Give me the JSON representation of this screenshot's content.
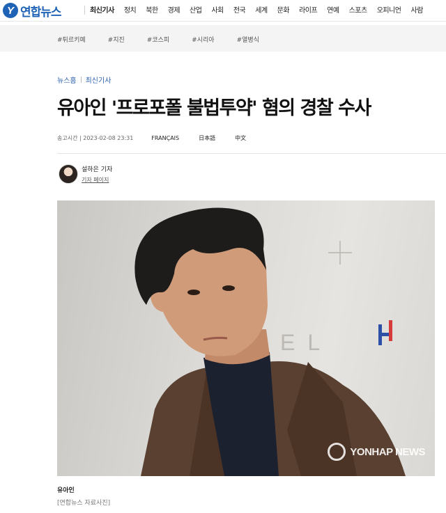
{
  "header": {
    "logo_mark": "Y",
    "logo_text": "연합뉴스",
    "menu": [
      "최신기사",
      "정치",
      "북한",
      "경제",
      "산업",
      "사회",
      "전국",
      "세계",
      "문화",
      "라이프",
      "연예",
      "스포츠",
      "오피니언",
      "사람"
    ]
  },
  "hashtags": [
    "#튀르키예",
    "#지진",
    "#코스피",
    "#시리아",
    "#열병식"
  ],
  "breadcrumb": [
    "뉴스홈",
    "최신기사"
  ],
  "article": {
    "headline": "유아인 '프로포폴 불법투약' 혐의 경찰 수사",
    "sent_label": "송고시간",
    "sent_time": "2023-02-08 23:31",
    "languages": [
      "FRANÇAIS",
      "日本語",
      "中文"
    ]
  },
  "author": {
    "name": "설하은 기자",
    "page_link": "기자 페이지"
  },
  "photo": {
    "watermark": "YONHAP NEWS",
    "backdrop_text": "EL",
    "caption": "유아인",
    "credit": "[연합뉴스 자료사진]"
  },
  "colors": {
    "brand": "#1f63b6",
    "jacket": "#5a4030",
    "sweater": "#1c2130"
  }
}
